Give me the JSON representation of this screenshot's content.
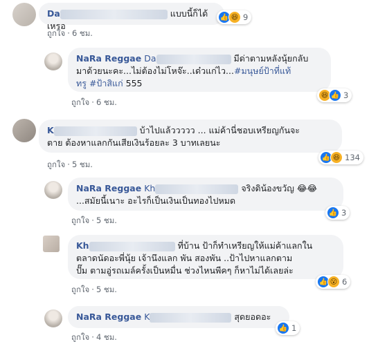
{
  "comments": [
    {
      "author": "Da",
      "text": "แบบนี้ก็ได้เหรอ",
      "like_label": "ถูกใจ",
      "time": "6 ชม.",
      "reaction_count": "9"
    },
    {
      "author": "NaRa Reggae",
      "mention": "Da",
      "text_part1": "มีด่าตามหลังนุ้ยกลับ",
      "text_part2": "มาด้วยนะคะ...ไม่ต้องไม่โหจ๊ะ..เด๋วแก่ไว...",
      "hashtag1": "#มนุษย์ป้าที่แท้",
      "hashtag1b": "ทรู",
      "hashtag2": "#ป้าสิแก่",
      "text_end": " 555",
      "like_label": "ถูกใจ",
      "time": "6 ชม.",
      "reaction_count": "3"
    },
    {
      "author": "K",
      "text_part1": "บ้าไปแล้ววววว ... แม่ค้านี่ชอบเหรียญกันจะ",
      "text_part2": "ตาย ต้องหาแลกกันเสียเงินร้อยละ 3 บาทเลยนะ",
      "like_label": "ถูกใจ",
      "time": "5 ชม.",
      "reaction_count": "134"
    },
    {
      "author": "NaRa Reggae",
      "mention": "Kh",
      "text_part1": "จริงดิน้องขวัญ 😂😂",
      "text_part2": "...สมัยนี้เนาะ อะไรก็เป็นเงินเป็นทองไปหมด",
      "like_label": "ถูกใจ",
      "time": "5 ชม.",
      "reaction_count": "3"
    },
    {
      "author": "Kh",
      "text_part1": "ที่บ้าน ป้าก็ทำเหรียญให้แม่ค้าแลกใน",
      "text_part2": "ตลาดนัดอะพี่นุ้ย เจ้านึงแลก พัน สองพัน ..ป้าไปหาแลกตาม",
      "text_part3": "ปั๊ม ตามอู่รถเมล์ครั้งเป็นหมื่น ช่วงไหนพีคๆ ก็หาไม่ได้เลยล่ะ",
      "like_label": "ถูกใจ",
      "time": "5 ชม.",
      "reaction_count": "6"
    },
    {
      "author": "NaRa Reggae",
      "mention": "K",
      "text": "สุดยอดอะ",
      "like_label": "ถูกใจ",
      "time": "4 ชม.",
      "reaction_count": "1"
    }
  ],
  "colors": {
    "link": "#385898",
    "bubble": "#f2f3f5",
    "like_blue": "#1877f2"
  }
}
